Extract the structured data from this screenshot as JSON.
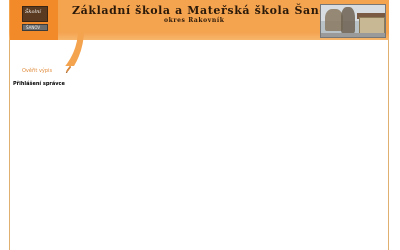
{
  "header": {
    "title": "Základní škola a Mateřská škola Šanov",
    "subtitle": "okres Rakovník",
    "logo": {
      "board_text": "Školní",
      "slate_text": "ŠANOV"
    },
    "photo": "school-building-photo"
  },
  "nav": {
    "link_label": "Ověřit výpis",
    "link_icon": "pencil-icon"
  },
  "main": {
    "heading": "Přihlášení správce"
  },
  "colors": {
    "header_orange": "#f4a34f",
    "link_orange": "#e08a3a"
  }
}
